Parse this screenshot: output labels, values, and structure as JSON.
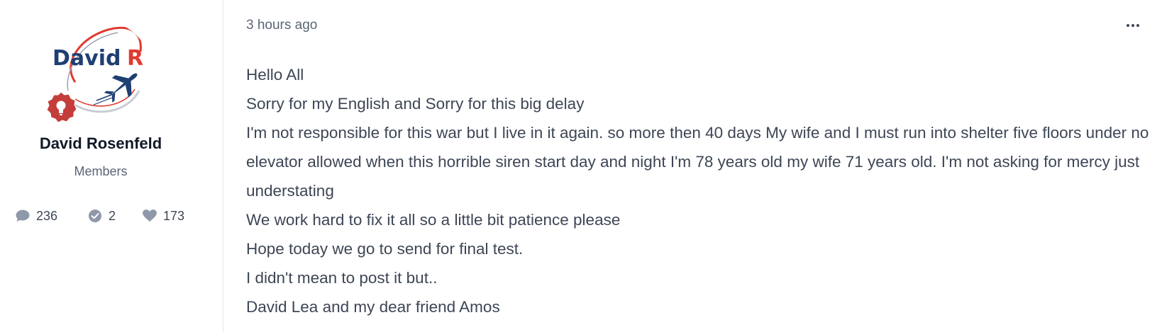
{
  "author": {
    "name": "David Rosenfeld",
    "group": "Members",
    "avatar_text": {
      "first": "David",
      "initial": "R"
    },
    "avatar_icon": "airplane-icon",
    "badge_icon": "lightbulb-icon",
    "stats": {
      "posts": "236",
      "solutions": "2",
      "reputation": "173"
    }
  },
  "post": {
    "timestamp": "3 hours ago",
    "more_icon": "ellipsis-icon",
    "lines": [
      "Hello All",
      "Sorry for my English and Sorry for this big delay",
      "I'm not responsible for this war but I live in it again. so more then 40 days My wife and I must run into shelter five floors under no elevator allowed when this horrible siren start day and night I'm 78 years old my wife 71 years old. I'm not asking for mercy just understating",
      "We work hard to fix it all so a little bit patience please",
      "Hope today we go to send for final test.",
      "I didn't mean to post it but..",
      "David Lea and my dear friend Amos"
    ]
  },
  "colors": {
    "avatar_blue": "#1f3f73",
    "avatar_red": "#e03a2f",
    "badge_red": "#c43d3a",
    "text": "#3d4655",
    "muted": "#5b6577",
    "icon_gray": "#8f98a8"
  }
}
